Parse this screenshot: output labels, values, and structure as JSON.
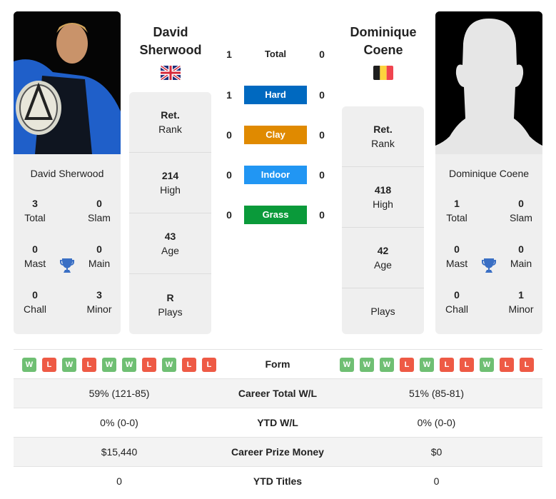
{
  "colors": {
    "hard": "#0069c0",
    "clay": "#e08a00",
    "indoor": "#2196f3",
    "grass": "#0a9a3a",
    "win": "#6fbf73",
    "loss": "#ee5a45",
    "trophy": "#3a6fc4"
  },
  "player1": {
    "name_line1": "David",
    "name_line2": "Sherwood",
    "full_name": "David Sherwood",
    "flag": "united-kingdom-flag",
    "titles": {
      "total": "3",
      "total_label": "Total",
      "slam": "0",
      "slam_label": "Slam",
      "mast": "0",
      "mast_label": "Mast",
      "main": "0",
      "main_label": "Main",
      "chall": "0",
      "chall_label": "Chall",
      "minor": "3",
      "minor_label": "Minor"
    },
    "info": {
      "rank_value": "Ret.",
      "rank_label": "Rank",
      "high_value": "214",
      "high_label": "High",
      "age_value": "43",
      "age_label": "Age",
      "plays_value": "R",
      "plays_label": "Plays"
    },
    "form": [
      "W",
      "L",
      "W",
      "L",
      "W",
      "W",
      "L",
      "W",
      "L",
      "L"
    ]
  },
  "player2": {
    "name_line1": "Dominique",
    "name_line2": "Coene",
    "full_name": "Dominique Coene",
    "flag": "belgium-flag",
    "titles": {
      "total": "1",
      "total_label": "Total",
      "slam": "0",
      "slam_label": "Slam",
      "mast": "0",
      "mast_label": "Mast",
      "main": "0",
      "main_label": "Main",
      "chall": "0",
      "chall_label": "Chall",
      "minor": "1",
      "minor_label": "Minor"
    },
    "info": {
      "rank_value": "Ret.",
      "rank_label": "Rank",
      "high_value": "418",
      "high_label": "High",
      "age_value": "42",
      "age_label": "Age",
      "plays_value": "",
      "plays_label": "Plays"
    },
    "form": [
      "W",
      "W",
      "W",
      "L",
      "W",
      "L",
      "L",
      "W",
      "L",
      "L"
    ]
  },
  "h2h": [
    {
      "label": "Total",
      "p1": "1",
      "p2": "0"
    },
    {
      "label": "Hard",
      "p1": "1",
      "p2": "0"
    },
    {
      "label": "Clay",
      "p1": "0",
      "p2": "0"
    },
    {
      "label": "Indoor",
      "p1": "0",
      "p2": "0"
    },
    {
      "label": "Grass",
      "p1": "0",
      "p2": "0"
    }
  ],
  "stats": {
    "form_label": "Form",
    "rows": [
      {
        "label": "Career Total W/L",
        "p1": "59% (121-85)",
        "p2": "51% (85-81)"
      },
      {
        "label": "YTD W/L",
        "p1": "0% (0-0)",
        "p2": "0% (0-0)"
      },
      {
        "label": "Career Prize Money",
        "p1": "$15,440",
        "p2": "$0"
      },
      {
        "label": "YTD Titles",
        "p1": "0",
        "p2": "0"
      }
    ]
  }
}
